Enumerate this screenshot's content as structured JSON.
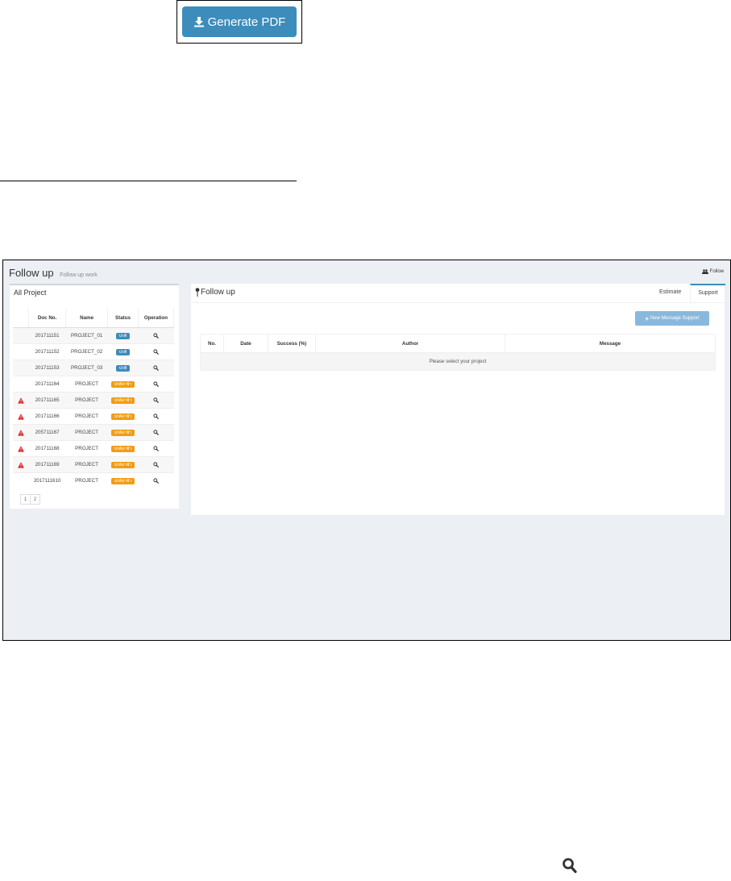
{
  "pdf_button": {
    "label": "Generate PDF",
    "icon": "download-icon"
  },
  "app": {
    "title": "Follow up",
    "subtitle": "Follow up work",
    "breadcrumb": "Follow",
    "left_box": {
      "title": "All Project",
      "columns": [
        "",
        "Doc No.",
        "Name",
        "Status",
        "Operation"
      ],
      "rows": [
        {
          "warning": false,
          "doc": "201711151",
          "name": "PROJECT_01",
          "status": "ปกติ",
          "status_color": "#3c8dbc"
        },
        {
          "warning": false,
          "doc": "201711152",
          "name": "PROJECT_02",
          "status": "ปกติ",
          "status_color": "#3c8dbc"
        },
        {
          "warning": false,
          "doc": "201711153",
          "name": "PROJECT_03",
          "status": "ปกติ",
          "status_color": "#3c8dbc"
        },
        {
          "warning": false,
          "doc": "201711164",
          "name": "PROJECT",
          "status": "ปกติล่าช้า",
          "status_color": "#f39c12"
        },
        {
          "warning": true,
          "doc": "201711165",
          "name": "PROJECT",
          "status": "ปกติล่าช้า",
          "status_color": "#f39c12"
        },
        {
          "warning": true,
          "doc": "201711166",
          "name": "PROJECT",
          "status": "ปกติล่าช้า",
          "status_color": "#f39c12"
        },
        {
          "warning": true,
          "doc": "205711167",
          "name": "PROJECT",
          "status": "ปกติล่าช้า",
          "status_color": "#f39c12"
        },
        {
          "warning": true,
          "doc": "201711168",
          "name": "PROJECT",
          "status": "ปกติล่าช้า",
          "status_color": "#f39c12"
        },
        {
          "warning": true,
          "doc": "201711169",
          "name": "PROJECT",
          "status": "ปกติล่าช้า",
          "status_color": "#f39c12"
        },
        {
          "warning": false,
          "doc": "2017111610",
          "name": "PROJECT",
          "status": "ปกติล่าช้า",
          "status_color": "#f39c12"
        }
      ],
      "pages": [
        "1",
        "2"
      ]
    },
    "right_box": {
      "title": "Follow up",
      "tabs": [
        "Estimate",
        "Support"
      ],
      "new_message_button": "New Message Support",
      "columns": [
        "No.",
        "Date",
        "Success (%)",
        "Author",
        "Message"
      ],
      "empty_text": "Please select your project"
    }
  },
  "colors": {
    "primary": "#3c8dbc",
    "warning": "#f39c12",
    "danger": "#dd1f1f",
    "bg": "#ecf0f5"
  }
}
